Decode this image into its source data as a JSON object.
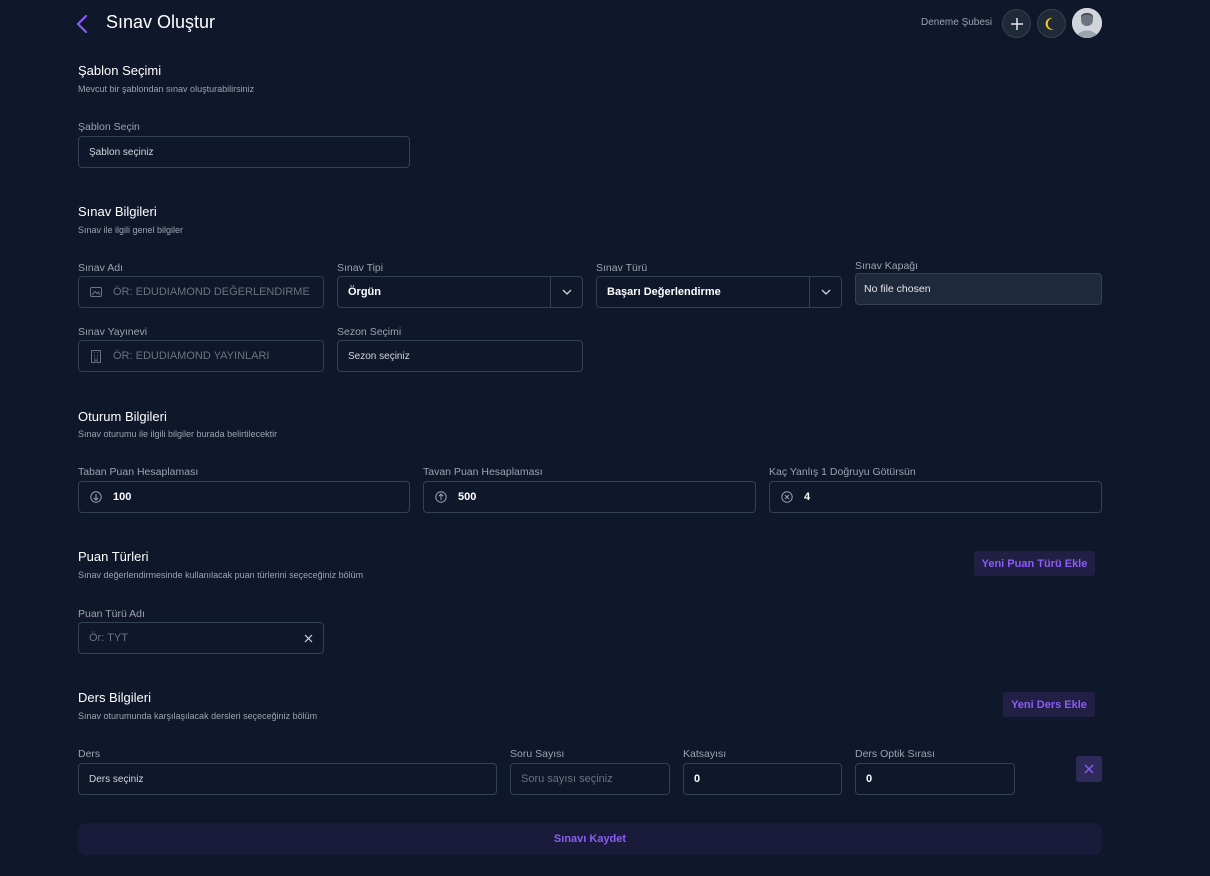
{
  "header": {
    "title": "Sınav Oluştur",
    "branch": "Deneme Şubesi"
  },
  "template_section": {
    "title": "Şablon Seçimi",
    "description": "Mevcut bir şablondan sınav oluşturabilirsiniz",
    "field_label": "Şablon Seçin",
    "field_value": "Şablon seçiniz"
  },
  "exam_info": {
    "title": "Sınav Bilgileri",
    "description": "Sınav ile ilgili genel bilgiler",
    "name_label": "Sınav Adı",
    "name_placeholder": "ÖR: EDUDIAMOND DEĞERLENDIRME",
    "type_label": "Sınav Tipi",
    "type_value": "Örgün",
    "kind_label": "Sınav Türü",
    "kind_value": "Başarı Değerlendirme",
    "cover_label": "Sınav Kapağı",
    "cover_value": "No file chosen",
    "publisher_label": "Sınav Yayınevi",
    "publisher_placeholder": "ÖR: EDUDIAMOND YAYINLARI",
    "season_label": "Sezon Seçimi",
    "season_value": "Sezon seçiniz"
  },
  "session_info": {
    "title": "Oturum Bilgileri",
    "description": "Sınav oturumu ile ilgili bilgiler burada belirtilecektir",
    "base_label": "Taban Puan Hesaplaması",
    "base_value": "100",
    "ceiling_label": "Tavan Puan Hesaplaması",
    "ceiling_value": "500",
    "wrong_label": "Kaç Yanlış 1 Doğruyu Götürsün",
    "wrong_value": "4"
  },
  "score_types": {
    "title": "Puan Türleri",
    "description": "Sınav değerlendirmesinde kullanılacak puan türlerini seçeceğiniz bölüm",
    "add_button": "Yeni Puan Türü Ekle",
    "name_label": "Puan Türü Adı",
    "name_placeholder": "Ör: TYT"
  },
  "lessons": {
    "title": "Ders Bilgileri",
    "description": "Sınav oturumunda karşılaşılacak dersleri seçeceğiniz bölüm",
    "add_button": "Yeni Ders Ekle",
    "lesson_label": "Ders",
    "lesson_value": "Ders seçiniz",
    "question_label": "Soru Sayısı",
    "question_placeholder": "Soru sayısı seçiniz",
    "coef_label": "Katsayısı",
    "coef_value": "0",
    "optic_label": "Ders Optik Sırası",
    "optic_value": "0"
  },
  "footer": {
    "save_button": "Sınavı Kaydet"
  },
  "colors": {
    "background": "#0f172a",
    "accent": "#8b5cf6",
    "border": "#334155",
    "moon": "#facc15"
  }
}
